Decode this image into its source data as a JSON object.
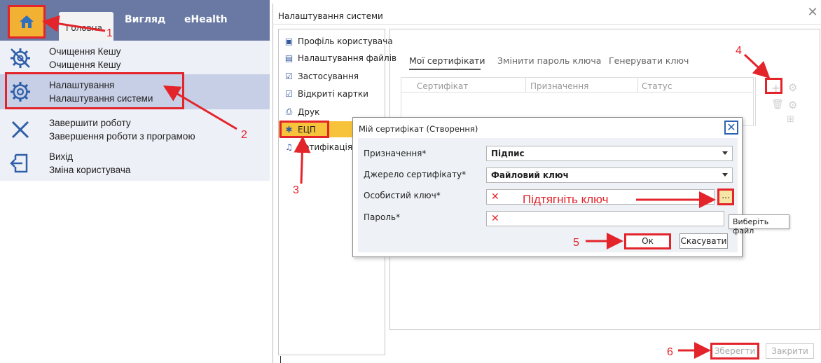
{
  "ribbon": {
    "tabs": [
      "Головна",
      "Вигляд",
      "eHealth"
    ]
  },
  "menu": [
    {
      "title": "Очищення Кешу",
      "subtitle": "Очищення Кешу",
      "icon": "gear-cross-icon"
    },
    {
      "title": "Налаштування",
      "subtitle": "Налаштування системи",
      "icon": "gear-icon"
    },
    {
      "title": "Завершити роботу",
      "subtitle": "Завершення роботи з програмою",
      "icon": "close-icon"
    },
    {
      "title": "Вихід",
      "subtitle": "Зміна користувача",
      "icon": "logout-icon"
    }
  ],
  "window": {
    "title": "Налаштування системи",
    "close": "✕"
  },
  "nav": [
    "Профіль користувача",
    "Налаштування файлів",
    "Застосування",
    "Відкриті картки",
    "Друк",
    "ЕЦП",
    "Нотифікація"
  ],
  "cert_tabs": [
    "Мої сертифікати",
    "Змінити пароль ключа",
    "Генерувати ключ"
  ],
  "table": {
    "columns": [
      "Сертифікат",
      "Призначення",
      "Статус"
    ]
  },
  "modal": {
    "title": "Мій сертифікат (Створення)",
    "fields": [
      {
        "label": "Призначення*",
        "value": "Підпис"
      },
      {
        "label": "Джерело сертифікату*",
        "value": "Файловий ключ"
      },
      {
        "label": "Особистий ключ*",
        "value": "✕"
      },
      {
        "label": "Пароль*",
        "value": "✕"
      }
    ],
    "browse": "...",
    "tooltip": "Виберіть файл",
    "ok": "Ок",
    "cancel": "Скасувати"
  },
  "footer": {
    "save": "Зберегти",
    "close": "Закрити"
  },
  "annotations": {
    "hint": "Підтягніть ключ",
    "steps": [
      "1",
      "2",
      "3",
      "4",
      "5",
      "6"
    ]
  },
  "colors": {
    "ribbon": "#6a79a3",
    "accent": "#f7c33b",
    "annotation": "#e3242b"
  }
}
